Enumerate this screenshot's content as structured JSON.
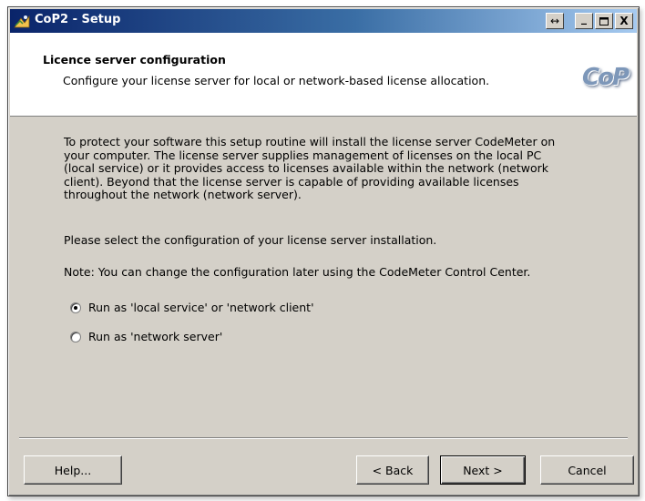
{
  "window": {
    "title": "CoP2 - Setup",
    "controls": {
      "restore_glyph": "↔",
      "minimize_glyph": "_",
      "close_glyph": "X"
    }
  },
  "header": {
    "title": "Licence server configuration",
    "subtitle": "Configure your license server for local or network-based license allocation.",
    "logo_text": "CoP"
  },
  "content": {
    "intro_lines": [
      "To protect your software this setup routine will install the license server CodeMeter on",
      "your computer. The license server supplies management of licenses on the local PC",
      "(local service) or it provides access to licenses available within the network (network",
      "client). Beyond that the license server is capable of providing available licenses",
      "throughout the network (network server)."
    ],
    "prompt": "Please select the configuration of your license server installation.",
    "note": "Note: You can change the configuration later using the CodeMeter Control Center.",
    "options": [
      {
        "label": "Run as 'local service' or 'network client'",
        "selected": true
      },
      {
        "label": "Run as 'network server'",
        "selected": false
      }
    ]
  },
  "buttons": {
    "help": "Help...",
    "back": "< Back",
    "next": "Next >",
    "cancel": "Cancel"
  },
  "colors": {
    "face": "#d4d0c8",
    "title_gradient_start": "#0a246a",
    "title_gradient_end": "#a6caf0",
    "logo": "#7d97b9"
  }
}
